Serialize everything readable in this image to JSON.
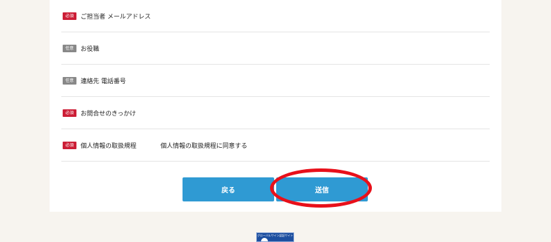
{
  "form": {
    "rows": [
      {
        "badge": "必須",
        "label": "ご担当者 メールアドレス",
        "value": ""
      },
      {
        "badge": "任意",
        "label": "お役職",
        "value": ""
      },
      {
        "badge": "任意",
        "label": "連絡先 電話番号",
        "value": ""
      },
      {
        "badge": "必須",
        "label": "お問合せのきっかけ",
        "value": ""
      },
      {
        "badge": "必須",
        "label": "個人情報の取扱規程",
        "value": "個人情報の取扱規程に同意する"
      }
    ]
  },
  "actions": {
    "back_label": "戻る",
    "submit_label": "送信"
  },
  "seal": {
    "text": "グローバルサイン認証サイト"
  },
  "colors": {
    "required_badge": "#cc1e36",
    "optional_badge": "#888888",
    "button": "#2f9ad3",
    "highlight_circle": "#e8101a"
  }
}
